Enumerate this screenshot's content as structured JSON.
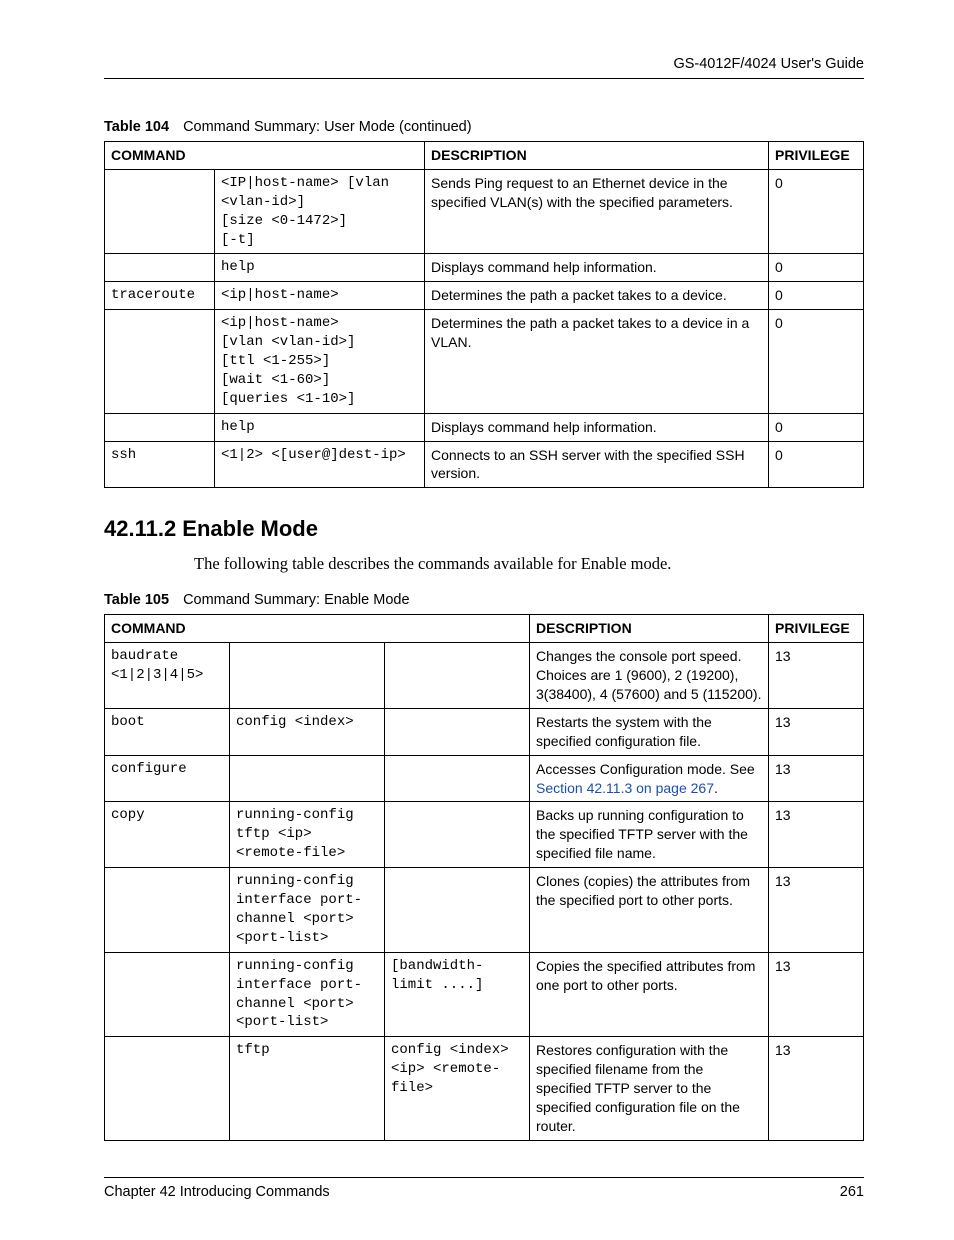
{
  "header": {
    "doc_title": "GS-4012F/4024 User's Guide"
  },
  "table104": {
    "label": "Table 104",
    "caption": "Command Summary: User Mode  (continued)",
    "headers": {
      "command": "COMMAND",
      "description": "DESCRIPTION",
      "privilege": "PRIVILEGE"
    },
    "rows": [
      {
        "c1": "",
        "c2": "<IP|host-name> [vlan <vlan-id>]\n[size <0-1472>]\n[-t]",
        "desc": "Sends Ping request to an Ethernet device in the specified VLAN(s) with the specified parameters.",
        "priv": "0"
      },
      {
        "c1": "",
        "c2": "help",
        "desc": "Displays command help information.",
        "priv": "0"
      },
      {
        "c1": "traceroute",
        "c2": "<ip|host-name>",
        "desc": "Determines the path a packet takes to a device.",
        "priv": "0"
      },
      {
        "c1": "",
        "c2": "<ip|host-name>\n[vlan <vlan-id>]\n[ttl <1-255>]\n[wait <1-60>]\n[queries <1-10>]",
        "desc": "Determines the path a packet takes to a device in a VLAN.",
        "priv": "0"
      },
      {
        "c1": "",
        "c2": "help",
        "desc": "Displays command help information.",
        "priv": "0"
      },
      {
        "c1": "ssh",
        "c2": "<1|2> <[user@]dest-ip>",
        "desc": "Connects to an SSH server with the specified SSH version.",
        "priv": "0"
      }
    ]
  },
  "section": {
    "number_title": "42.11.2  Enable Mode",
    "body": "The following table describes the commands available for Enable mode."
  },
  "table105": {
    "label": "Table 105",
    "caption": "Command Summary: Enable Mode",
    "headers": {
      "command": "COMMAND",
      "description": "DESCRIPTION",
      "privilege": "PRIVILEGE"
    },
    "rows": [
      {
        "c1": "baudrate <1|2|3|4|5>",
        "c2": "",
        "c3": "",
        "desc": "Changes the console port speed. Choices are 1 (9600), 2 (19200), 3(38400), 4 (57600) and 5 (115200).",
        "priv": "13"
      },
      {
        "c1": "boot",
        "c2": "config <index>",
        "c3": "",
        "desc": "Restarts the system with the specified configuration file.",
        "priv": "13"
      },
      {
        "c1": "configure",
        "c2": "",
        "c3": "",
        "desc_pre": "Accesses Configuration mode. See ",
        "link": "Section 42.11.3 on page 267",
        "desc_post": ".",
        "priv": "13"
      },
      {
        "c1": "copy",
        "c2": "running-config tftp <ip> <remote-file>",
        "c3": "",
        "desc": "Backs up running configuration to the specified TFTP server with the specified file name.",
        "priv": "13"
      },
      {
        "c1": "",
        "c2": "running-config interface port-channel <port> <port-list>",
        "c3": "",
        "desc": "Clones (copies) the attributes from the specified port to other ports.",
        "priv": "13"
      },
      {
        "c1": "",
        "c2": "running-config interface port-channel <port> <port-list>",
        "c3": "[bandwidth-limit ....]",
        "desc": "Copies the specified attributes from one port to other ports.",
        "priv": "13"
      },
      {
        "c1": "",
        "c2": "tftp",
        "c3": "config <index> <ip> <remote-file>",
        "desc": "Restores configuration with the specified filename from the specified TFTP server to the specified configuration file on the router.",
        "priv": "13"
      }
    ]
  },
  "footer": {
    "chapter": "Chapter 42 Introducing Commands",
    "page": "261"
  }
}
